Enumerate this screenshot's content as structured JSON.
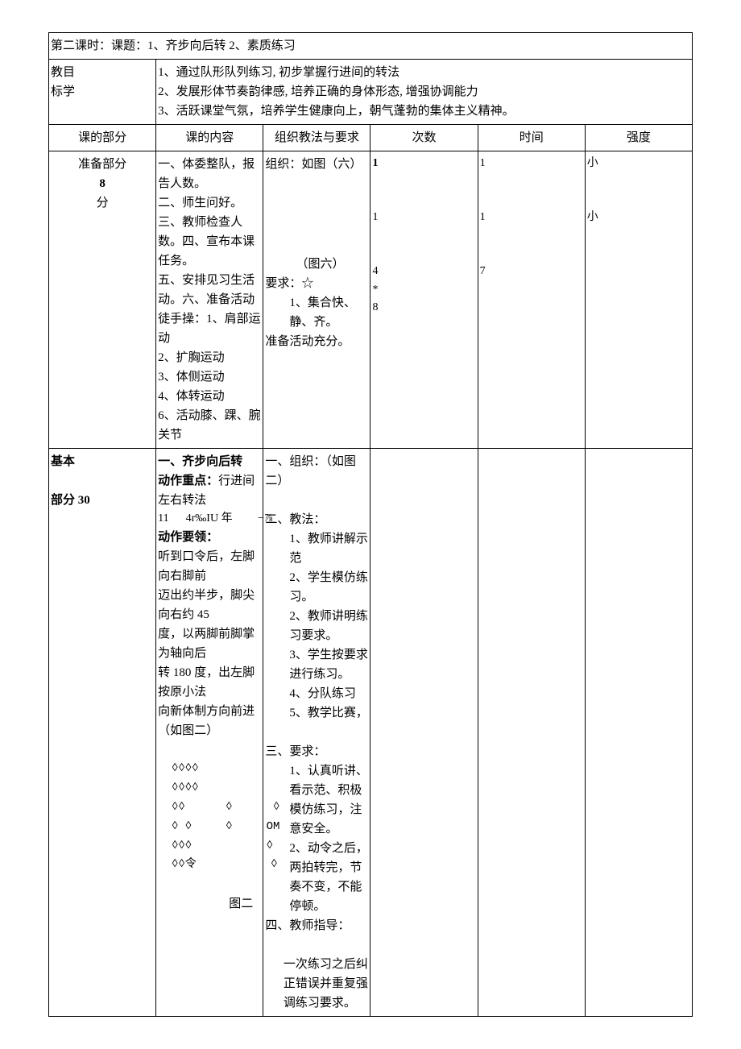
{
  "row1": {
    "label": "第二课时：课题：1、齐步向后转 2、素质练习"
  },
  "row2": {
    "left": "教目\n标学",
    "goals": [
      "1、通过队形队列练习, 初步掌握行进间的转法",
      "2、发展形体节奏韵律感, 培养正确的身体形态, 增强协调能力",
      "3、活跃课堂气氛，培养学生健康向上，朝气蓬勃的集体主义精神。"
    ]
  },
  "header": {
    "part": "课的部分",
    "content": "课的内容",
    "method": "组织教法与要求",
    "times": "次数",
    "time": "时间",
    "intensity": "强度"
  },
  "prep": {
    "part_label": "准备部分",
    "part_time": "8",
    "part_unit": "分",
    "content_lines": [
      "一、体委整队，报告人数。",
      "二、师生问好。",
      "三、教师检查人数。四、宣布本课任务。",
      "",
      "五、安排见习生活动。六、准备活动徒手操：1、肩部运动",
      "2、扩胸运动",
      "3、体侧运动",
      "4、体转运动",
      "6、活动膝、踝、腕关节"
    ],
    "method_top": "组织：如图（六）",
    "method_caption": "（图六）",
    "method_req_title": "要求：☆",
    "method_req_1": "1、集合快、静、齐。",
    "method_req_2": "准备活动充分。",
    "times_col": [
      "1",
      "",
      "1",
      "",
      "4\n*\n8"
    ],
    "time_col": [
      "1",
      "",
      "1",
      "",
      "7"
    ],
    "intensity_col": [
      "小",
      "",
      "",
      "小",
      ""
    ]
  },
  "basic": {
    "part_label": "基本",
    "part_label2": "部分 30",
    "content": {
      "title": "一、齐步向后转",
      "keypoint_label": "动作重点：",
      "keypoint_text": "行进间左右转法",
      "extra_line": "11      4r‰IU 年         −⅞",
      "yaoling_label": "动作要领：",
      "yaoling_text": [
        "听到口令后，左脚向右脚前",
        "迈出约半步，脚尖向右约 45",
        "度，以两脚前脚掌为轴向后",
        "转 180 度，出左脚按原小法",
        "向新体制方向前进（如图二）"
      ],
      "diagram": "  ◊◊◊◊\n  ◊◊◊◊\n  ◊◊      ◊      ◊\n  ◊ ◊     ◊     OM\n  ◊◊◊           ◊\n  ◊◊令           ◊",
      "fig_caption": "图二"
    },
    "method": {
      "sec1_title": "一、组织：（如图二）",
      "sec2_title": "二、教法：",
      "sec2_items": [
        "1、教师讲解示范",
        "2、学生模仿练习。",
        "2、教师讲明练习要求。",
        "3、学生按要求进行练习。",
        "4、分队练习",
        "5、教学比赛，"
      ],
      "sec3_title": "三、要求：",
      "sec3_items": [
        "1、认真听讲、看示范、积极模仿练习，注意安全。",
        "2、动令之后，两拍转完，节奏不变，不能停顿。"
      ],
      "sec4_title": "四、教师指导：",
      "sec4_text": "一次练习之后纠正错误并重复强调练习要求。"
    }
  }
}
